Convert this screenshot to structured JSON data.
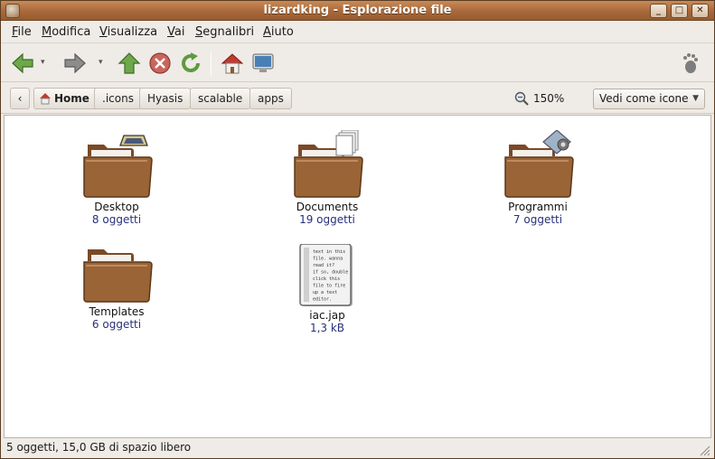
{
  "window": {
    "title": "lizardking - Esplorazione file"
  },
  "menubar": [
    {
      "label": "File",
      "mn": "F",
      "rest": "ile"
    },
    {
      "label": "Modifica",
      "mn": "M",
      "rest": "odifica"
    },
    {
      "label": "Visualizza",
      "mn": "V",
      "rest": "isualizza"
    },
    {
      "label": "Vai",
      "mn": "V",
      "rest": "ai"
    },
    {
      "label": "Segnalibri",
      "mn": "S",
      "rest": "egnalibri"
    },
    {
      "label": "Aiuto",
      "mn": "A",
      "rest": "iuto"
    }
  ],
  "location": {
    "crumbs": [
      "Home",
      ".icons",
      "Hyasis",
      "scalable",
      "apps"
    ],
    "zoom": "150%",
    "view_mode": "Vedi come icone"
  },
  "items": [
    {
      "name": "Desktop",
      "info": "8 oggetti",
      "type": "folder",
      "emblem": "desktop"
    },
    {
      "name": "Documents",
      "info": "19 oggetti",
      "type": "folder",
      "emblem": "documents"
    },
    {
      "name": "Programmi",
      "info": "7 oggetti",
      "type": "folder",
      "emblem": "programs"
    },
    {
      "name": "Templates",
      "info": "6 oggetti",
      "type": "folder",
      "emblem": "none"
    },
    {
      "name": "iac.jap",
      "info": "1,3 kB",
      "type": "text-file",
      "preview": [
        "text in this",
        "file. wanna",
        "read it?",
        "if so, double",
        "click this",
        "file to fire",
        "up a text",
        "editor."
      ]
    }
  ],
  "status": "5 oggetti, 15,0 GB di spazio libero",
  "colors": {
    "titlebar": "#a8683a",
    "folder": "#9a6437",
    "accent": "#27307a"
  }
}
